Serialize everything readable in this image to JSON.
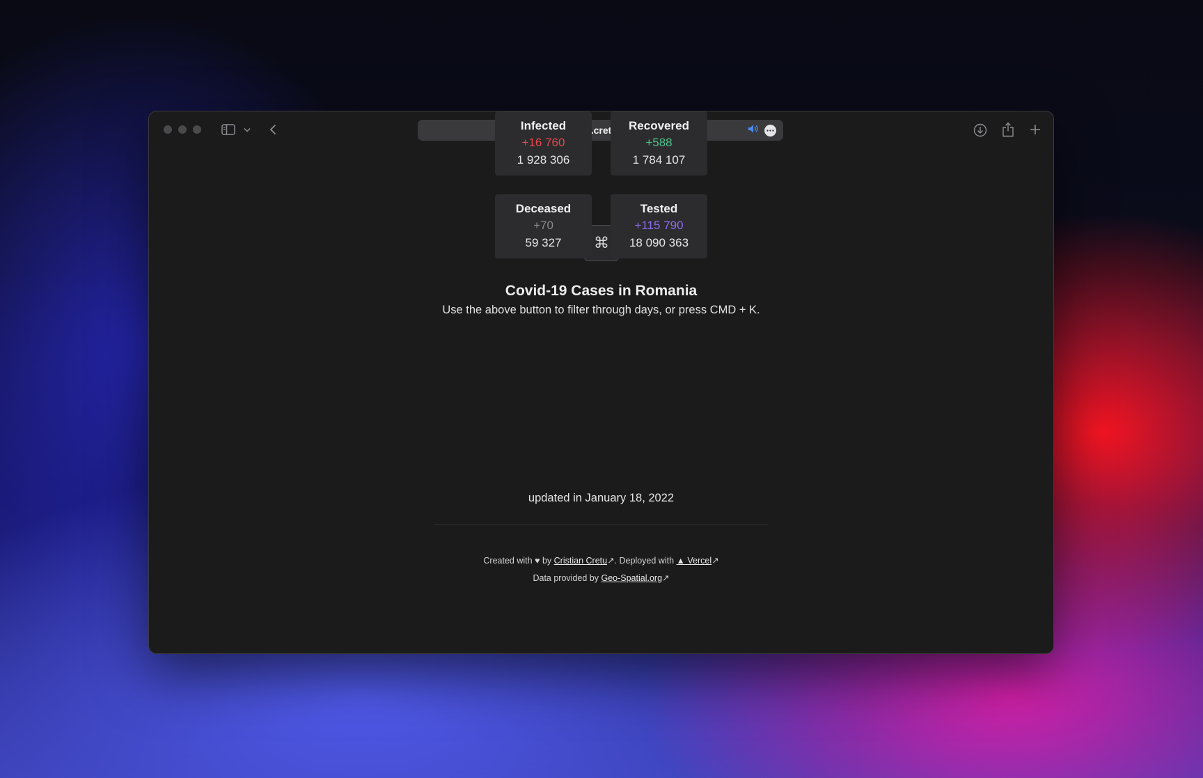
{
  "browser": {
    "url": "covid.cretu.dev",
    "icons": {
      "site": "vercel-triangle-icon",
      "lock": "lock-icon",
      "audio": "speaker-icon",
      "more": "ellipsis-icon",
      "sidebar": "sidebar-icon",
      "chevron": "chevron-down-icon",
      "back": "chevron-left-icon",
      "download": "download-icon",
      "share": "share-icon",
      "new_tab": "plus-icon"
    }
  },
  "page": {
    "command_icon": "⌘",
    "title": "Covid-19 Cases in Romania",
    "subtitle": "Use the above button to filter through days, or press CMD + K.",
    "stats": {
      "infected": {
        "label": "Infected",
        "delta": "+16 760",
        "total": "1 928 306",
        "color": "#e5484d"
      },
      "recovered": {
        "label": "Recovered",
        "delta": "+588",
        "total": "1 784 107",
        "color": "#4cc38a"
      },
      "deceased": {
        "label": "Deceased",
        "delta": "+70",
        "total": "59 327",
        "color": "#8a8a8e"
      },
      "tested": {
        "label": "Tested",
        "delta": "+115 790",
        "total": "18 090 363",
        "color": "#8e6cf0"
      }
    },
    "updated": "updated in January 18, 2022"
  },
  "footer": {
    "created_prefix": "Created with",
    "heart": "♥",
    "by": "by",
    "author": "Cristian Cretu",
    "deployed": ". Deployed with",
    "vercel": "▲ Vercel",
    "data_prefix": "Data provided by",
    "data_source": "Geo-Spatial.org",
    "arrow": "↗"
  }
}
